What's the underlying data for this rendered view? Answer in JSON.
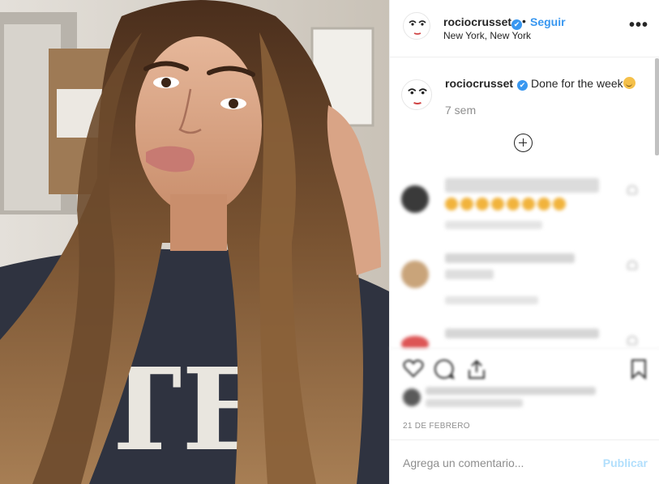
{
  "post": {
    "photo_description_icon": "portrait-photo",
    "header": {
      "username": "rociocrusset",
      "verified": "✔",
      "separator": "•",
      "follow_label": "Seguir",
      "location": "New York, New York",
      "more_label": "•••"
    },
    "caption": {
      "username": "rociocrusset",
      "verified": "✔",
      "text": "Done for the week",
      "time_ago": "7 sem"
    },
    "load_more_icon": "plus-circle-icon",
    "comments": [
      {
        "username": "",
        "text": "",
        "meta": "",
        "avatar_color": "#3a3a3a"
      },
      {
        "username": "",
        "text": "",
        "meta": "",
        "avatar_color": "#c9a47a"
      },
      {
        "username": "",
        "text": "",
        "meta": "",
        "avatar_color": "#d44"
      }
    ],
    "actions": {
      "icons": [
        "heart-icon",
        "comment-icon",
        "share-icon",
        "bookmark-icon"
      ]
    },
    "likes": {
      "text": ""
    },
    "date": "21 DE FEBRERO",
    "add_comment": {
      "placeholder": "Agrega un comentario...",
      "publish_label": "Publicar"
    }
  },
  "colors": {
    "accent": "#3897f0",
    "publish_disabled": "#b2dffc",
    "muted": "#8e8e8e",
    "border": "#efefef"
  }
}
